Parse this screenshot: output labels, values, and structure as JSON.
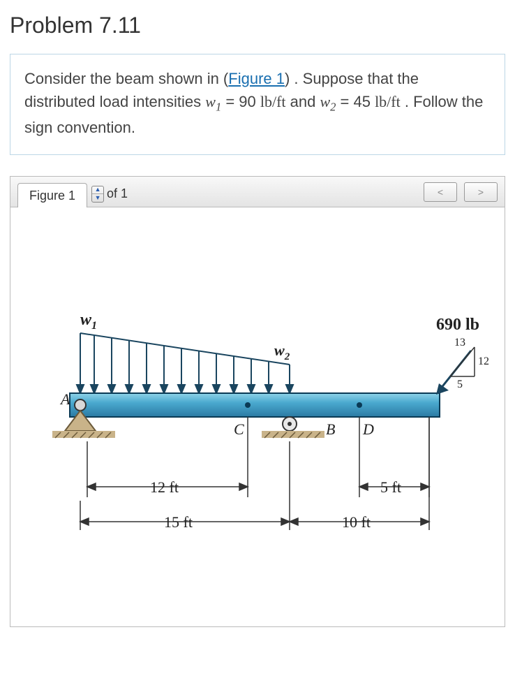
{
  "title": "Problem 7.11",
  "problem": {
    "prefix": "Consider the beam shown in (",
    "link_text": "Figure 1",
    "after_link": ") . Suppose that the distributed load intensities ",
    "w1_sym": "w",
    "w1_sub": "1",
    "w1_eq": " = 90  ",
    "unit1": "lb/ft",
    "mid": " and ",
    "w2_sym": "w",
    "w2_sub": "2",
    "w2_eq": " = 45  ",
    "unit2": "lb/ft",
    "tail": " . Follow the sign convention."
  },
  "figure_bar": {
    "tab": "Figure 1",
    "of_text": "of 1",
    "prev": "<",
    "next": ">"
  },
  "diagram": {
    "w1_label": "w",
    "w1_sub": "1",
    "w2_label": "w",
    "w2_sub": "2",
    "point_load": "690 lb",
    "slope_num": "13",
    "slope_den": "12",
    "slope_base": "5",
    "A": "A",
    "B": "B",
    "C": "C",
    "D": "D",
    "dim12": "12 ft",
    "dim15": "15 ft",
    "dim10": "10 ft",
    "dim5": "5 ft"
  }
}
